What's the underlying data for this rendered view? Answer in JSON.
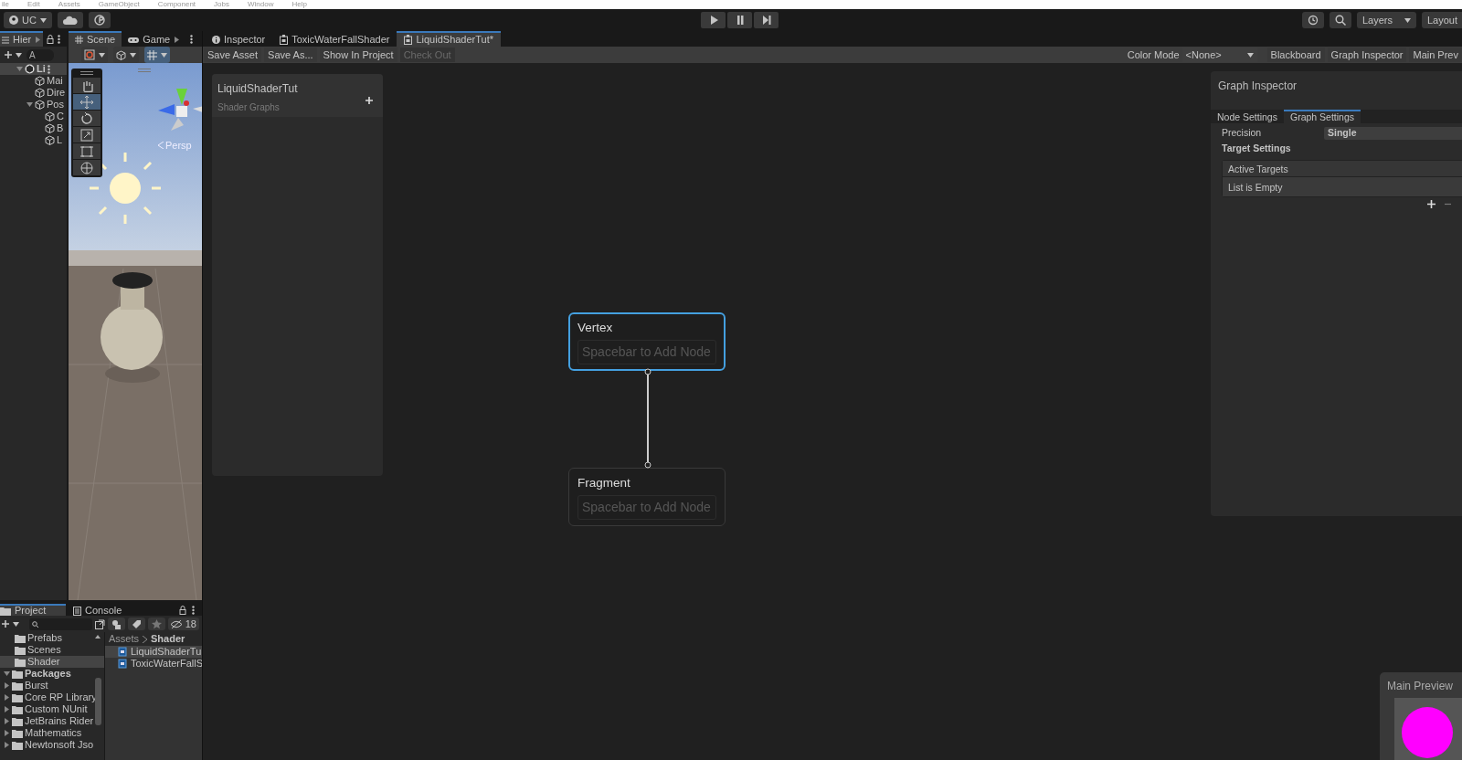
{
  "menu_bar": [
    "ile",
    "Edit",
    "Assets",
    "GameObject",
    "Component",
    "Jobs",
    "Window",
    "Help"
  ],
  "toolbar": {
    "account": "UC",
    "layers": "Layers",
    "layout": "Layout"
  },
  "hierarchy": {
    "tab": "Hier",
    "search_placeholder": "A",
    "items": [
      {
        "label": "Li",
        "kind": "scene",
        "expanded": true,
        "children": [
          {
            "label": "Mai",
            "kind": "object"
          },
          {
            "label": "Dire",
            "kind": "object"
          },
          {
            "label": "Pos",
            "kind": "object",
            "expanded": true,
            "children": [
              {
                "label": "C",
                "kind": "object"
              },
              {
                "label": "B",
                "kind": "object"
              },
              {
                "label": "L",
                "kind": "object"
              }
            ]
          }
        ]
      }
    ]
  },
  "scene_tabs": [
    {
      "label": "Scene",
      "kind": "scene",
      "selected": true
    },
    {
      "label": "Game",
      "kind": "game",
      "selected": false
    }
  ],
  "scene_view": {
    "kind": "picture",
    "projection": "Persp",
    "tools": [
      {
        "kind": "hand",
        "selected": false
      },
      {
        "kind": "move",
        "selected": true
      },
      {
        "kind": "rotate",
        "selected": false
      },
      {
        "kind": "scale",
        "selected": false
      },
      {
        "kind": "rect",
        "selected": false
      },
      {
        "kind": "transform",
        "selected": false
      }
    ]
  },
  "project": {
    "tabs": [
      {
        "label": "Project",
        "selected": true
      },
      {
        "label": "Console",
        "selected": false
      }
    ],
    "hidden_count": "18",
    "folders": [
      {
        "label": "Prefabs",
        "selected": false
      },
      {
        "label": "Scenes",
        "selected": false
      },
      {
        "label": "Shader",
        "selected": true
      },
      {
        "label": "Packages",
        "selected": false,
        "expanded": true,
        "children": [
          {
            "label": "Burst",
            "selected": false,
            "expanded": false
          },
          {
            "label": "Core RP Library",
            "selected": false,
            "expanded": false
          },
          {
            "label": "Custom NUnit",
            "selected": false,
            "expanded": false
          },
          {
            "label": "JetBrains Rider",
            "selected": false,
            "expanded": false
          },
          {
            "label": "Mathematics",
            "selected": false,
            "expanded": false
          },
          {
            "label": "Newtonsoft Jso",
            "selected": false,
            "expanded": false
          }
        ]
      }
    ],
    "breadcrumb": [
      "Assets",
      "Shader"
    ],
    "files": [
      {
        "label": "LiquidShaderTu",
        "selected": true
      },
      {
        "label": "ToxicWaterFallS",
        "selected": false
      }
    ]
  },
  "editor_tabs": [
    {
      "label": "Inspector",
      "kind": "inspector",
      "selected": false
    },
    {
      "label": "ToxicWaterFallShader",
      "kind": "shader",
      "selected": false
    },
    {
      "label": "LiquidShaderTut*",
      "kind": "shader",
      "selected": true
    }
  ],
  "graph_toolbar": {
    "buttons": [
      {
        "label": "Save Asset",
        "disabled": false
      },
      {
        "label": "Save As...",
        "disabled": false
      },
      {
        "label": "Show In Project",
        "disabled": false
      },
      {
        "label": "Check Out",
        "disabled": true
      }
    ],
    "color_mode_label": "Color Mode",
    "color_mode": "<None>",
    "toggles": [
      "Blackboard",
      "Graph Inspector",
      "Main Prev"
    ]
  },
  "blackboard": {
    "title": "LiquidShaderTut",
    "subtitle": "Shader Graphs"
  },
  "graph_inspector": {
    "title": "Graph Inspector",
    "tabs": [
      {
        "label": "Node Settings",
        "selected": false
      },
      {
        "label": "Graph Settings",
        "selected": true
      }
    ],
    "precision_label": "Precision",
    "precision": "Single",
    "target_settings": "Target Settings",
    "active_targets": "Active Targets",
    "list_status": "List is Empty"
  },
  "nodes": [
    {
      "title": "Vertex",
      "selected": true,
      "hint": "Spacebar to Add Node"
    },
    {
      "title": "Fragment",
      "selected": false,
      "hint": "Spacebar to Add Node"
    }
  ],
  "main_preview": {
    "title": "Main Preview"
  }
}
